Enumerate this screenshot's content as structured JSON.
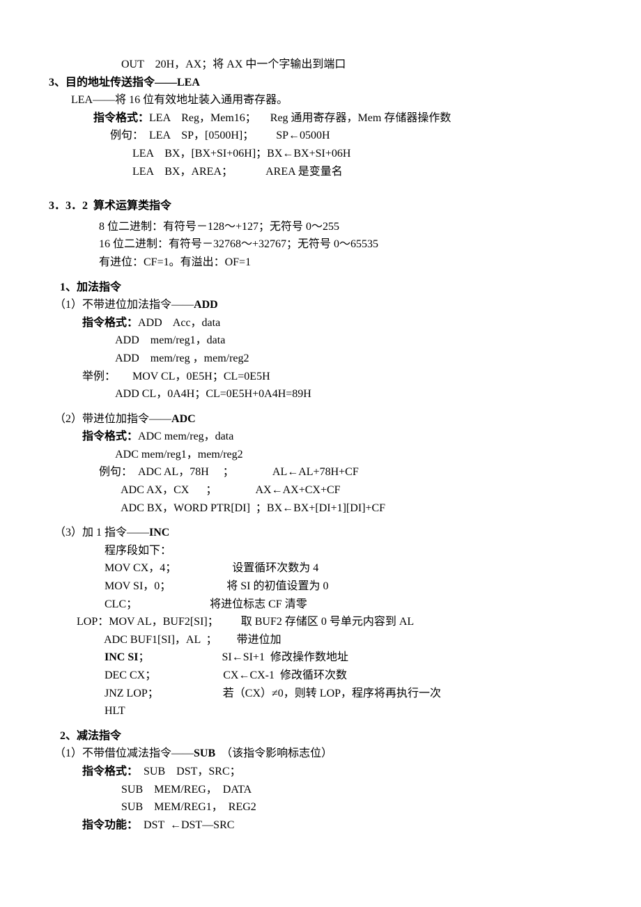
{
  "top_out": "                          OUT    20H，AX；将 AX 中一个字输出到端口",
  "sec3_title": "3、目的地址传送指令——LEA",
  "sec3_lea_desc": "        LEA——将 16 位有效地址装入通用寄存器。",
  "sec3_fmt_label": "                指令格式：",
  "sec3_fmt_rest": "LEA    Reg，Mem16；     Reg 通用寄存器，Mem 存储器操作数",
  "sec3_ex1": "                      例句：  LEA    SP，[0500H]；        SP←0500H",
  "sec3_ex2": "                              LEA    BX，[BX+SI+06H]；BX←BX+SI+06H",
  "sec3_ex3": "                              LEA    BX，AREA；            AREA 是变量名",
  "h332": "3．3．2  算术运算类指令",
  "h332_l1": "                  8 位二进制：有符号－128～+127；无符号 0～255",
  "h332_l2": "                  16 位二进制：有符号－32768～+32767；无符号 0～65535",
  "h332_l3": "                  有进位：CF=1。有溢出：OF=1",
  "add_head": "    1、加法指令",
  "add1_title_pre": "  （1）不带进位加法指令——",
  "add1_title_bold": "ADD",
  "add1_fmt_label": "            指令格式：",
  "add1_fmt_rest": "ADD    Acc，data",
  "add1_l2": "                        ADD    mem/reg1，data",
  "add1_l3": "                        ADD    mem/reg ，mem/reg2",
  "add1_l4": "            举例：      MOV CL，0E5H；CL=0E5H",
  "add1_l5": "                        ADD CL，0A4H；CL=0E5H+0A4H=89H",
  "adc_title_pre": "  （2）带进位加指令——",
  "adc_title_bold": "ADC",
  "adc_fmt_label": "            指令格式：",
  "adc_fmt_rest": "ADC mem/reg，data",
  "adc_l2": "                        ADC mem/reg1，mem/reg2",
  "adc_l3": "                  例句：  ADC AL，78H     ；              AL←AL+78H+CF",
  "adc_l4": "                          ADC AX，CX      ；              AX←AX+CX+CF",
  "adc_l5": "                          ADC BX，WORD PTR[DI]  ；BX←BX+[DI+1][DI]+CF",
  "inc_title_pre": "  （3）加 1 指令——",
  "inc_title_bold": "INC",
  "inc_l1": "                    程序段如下：",
  "inc_l2": "                    MOV CX，4；                    设置循环次数为 4",
  "inc_l3": "                    MOV SI，0；                    将 SI 的初值设置为 0",
  "inc_l4": "                    CLC；                          将进位标志 CF 清零",
  "inc_l5": "          LOP：MOV AL，BUF2[SI]；        取 BUF2 存储区 0 号单元内容到 AL",
  "inc_l6": "                    ADC BUF1[SI]，AL  ；       带进位加",
  "inc_l7_pre": "                    ",
  "inc_l7_bold": "INC SI",
  "inc_l7_rest": "；                          SI←SI+1  修改操作数地址",
  "inc_l8": "                    DEC CX；                        CX←CX-1  修改循环次数",
  "inc_l9": "                    JNZ LOP；                       若（CX）≠0，则转 LOP，程序将再执行一次",
  "inc_l10": "                    HLT",
  "sub_head": "    2、减法指令",
  "sub1_title_pre": "  （1）不带借位减法指令——",
  "sub1_title_bold": "SUB",
  "sub1_title_rest": "  （该指令影响标志位）",
  "sub1_fmt_label": "            指令格式：",
  "sub1_fmt_rest": "  SUB    DST，SRC；",
  "sub1_l2": "                          SUB    MEM/REG，  DATA",
  "sub1_l3": "                          SUB    MEM/REG1，  REG2",
  "sub1_fn_label": "            指令功能：",
  "sub1_fn_rest": "  DST  ←DST—SRC"
}
